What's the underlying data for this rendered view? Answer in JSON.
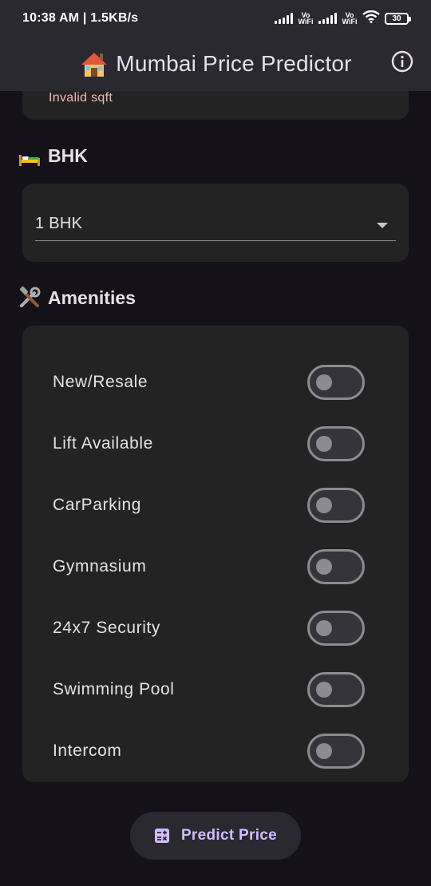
{
  "status_bar": {
    "time": "10:38 AM | 1.5KB/s",
    "vo_wifi_1": "Vo WiFi",
    "vo_wifi_2": "Vo WiFi",
    "battery": "30"
  },
  "app_bar": {
    "title": "Mumbai Price Predictor",
    "title_icon": "house-icon",
    "info_icon": "info-icon"
  },
  "sqft_card": {
    "error": "Invalid sqft"
  },
  "bhk_section": {
    "heading": "BHK",
    "icon": "bed-icon",
    "selected": "1 BHK"
  },
  "amenities_section": {
    "heading": "Amenities",
    "icon": "tools-icon",
    "items": [
      {
        "label": "New/Resale",
        "on": false
      },
      {
        "label": "Lift Available",
        "on": false
      },
      {
        "label": "CarParking",
        "on": false
      },
      {
        "label": "Gymnasium",
        "on": false
      },
      {
        "label": "24x7 Security",
        "on": false
      },
      {
        "label": "Swimming Pool",
        "on": false
      },
      {
        "label": "Intercom",
        "on": false
      }
    ]
  },
  "predict_button": {
    "label": "Predict Price",
    "icon": "calculator-icon"
  },
  "colors": {
    "background": "#141218",
    "surface": "#232323",
    "app_bar": "#2b2930",
    "accent": "#d0bcff",
    "error": "#f2b8b5"
  }
}
